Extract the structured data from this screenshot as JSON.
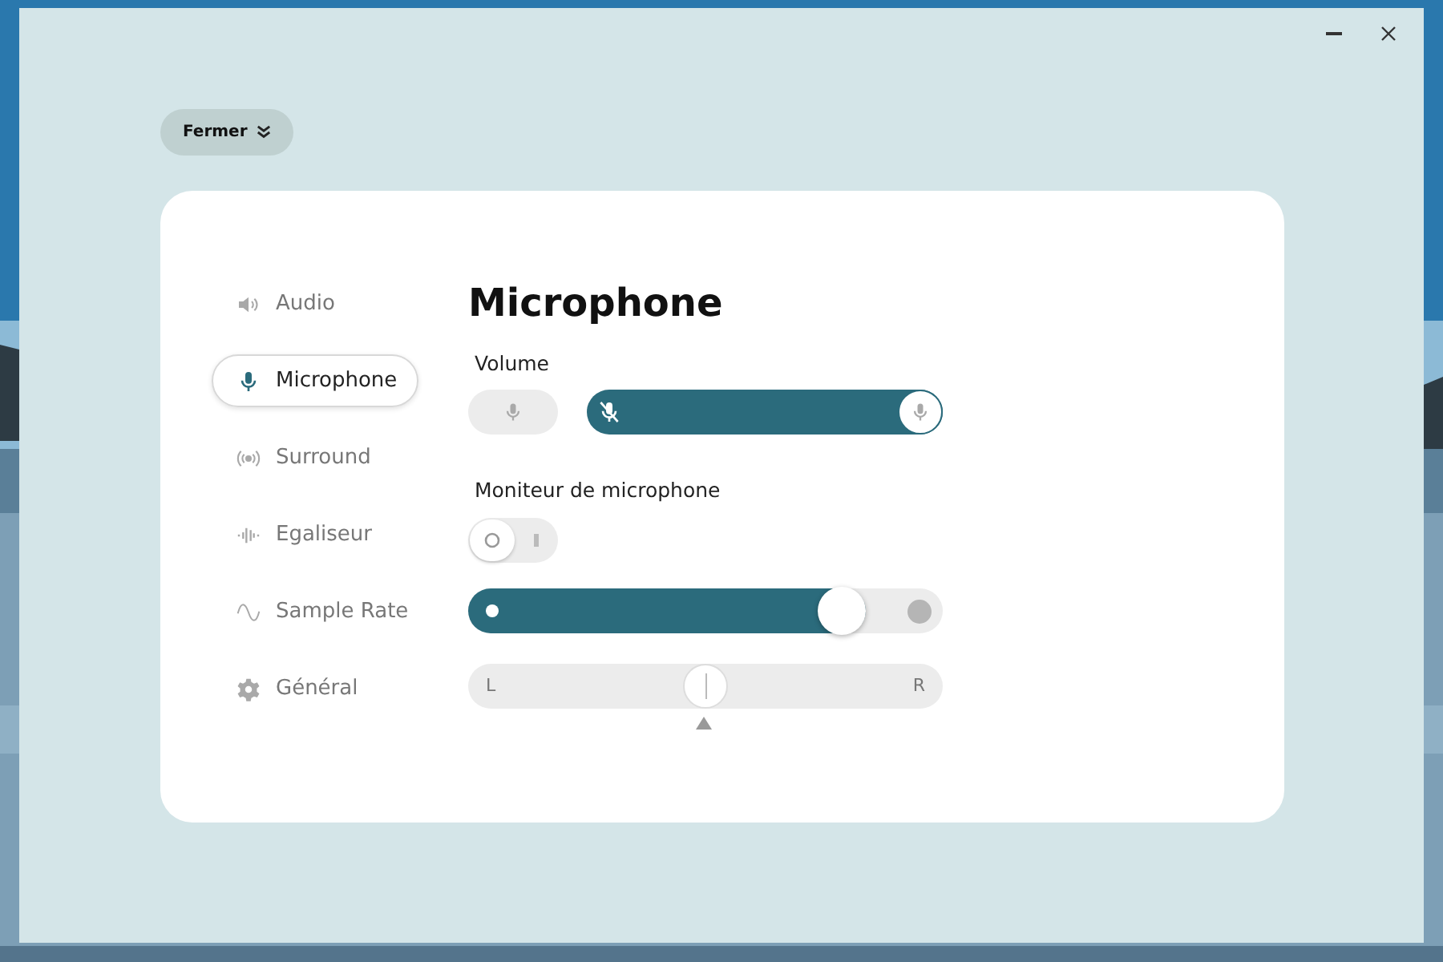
{
  "menu_button": {
    "label": "Fermer"
  },
  "sidebar": {
    "items": [
      {
        "label": "Audio",
        "selected": false
      },
      {
        "label": "Microphone",
        "selected": true
      },
      {
        "label": "Surround",
        "selected": false
      },
      {
        "label": "Egaliseur",
        "selected": false
      },
      {
        "label": "Sample Rate",
        "selected": false
      },
      {
        "label": "Général",
        "selected": false
      }
    ]
  },
  "title": "Microphone",
  "volume": {
    "label": "Volume",
    "level": 1
  },
  "monitor": {
    "label": "Moniteur de microphone",
    "on": false,
    "level": 0.82
  },
  "balance": {
    "left": "L",
    "right": "R",
    "level": 0.5
  }
}
